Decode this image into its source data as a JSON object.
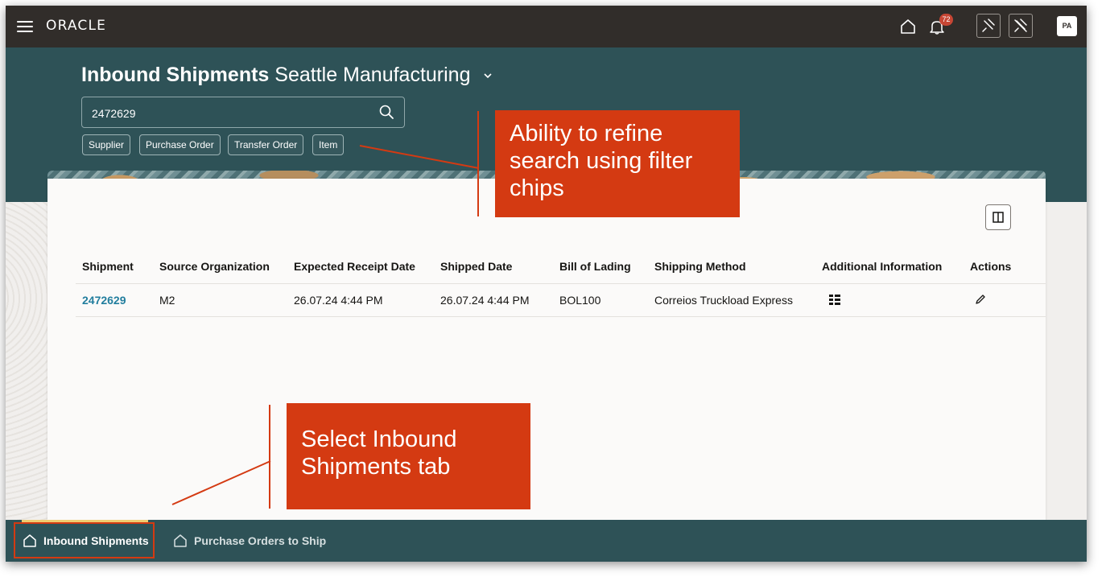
{
  "topbar": {
    "brand": "ORACLE",
    "notification_count": "72",
    "avatar_initials": "PA",
    "icons": [
      "menu-icon",
      "home-icon",
      "bell-icon",
      "pin-icon",
      "unpin-icon"
    ]
  },
  "header": {
    "title": "Inbound Shipments",
    "organization": "Seattle Manufacturing",
    "search_value": "2472629",
    "filter_chips": [
      "Supplier",
      "Purchase Order",
      "Transfer Order",
      "Item"
    ]
  },
  "table": {
    "columns": [
      "Shipment",
      "Source Organization",
      "Expected Receipt Date",
      "Shipped Date",
      "Bill of Lading",
      "Shipping Method",
      "Additional Information",
      "Actions"
    ],
    "rows": [
      {
        "shipment": "2472629",
        "source_organization": "M2",
        "expected_receipt_date": "26.07.24 4:44 PM",
        "shipped_date": "26.07.24 4:44 PM",
        "bill_of_lading": "BOL100",
        "shipping_method": "Correios Truckload Express"
      }
    ]
  },
  "bottom_tabs": [
    {
      "label": "Inbound Shipments",
      "active": true
    },
    {
      "label": "Purchase Orders to Ship",
      "active": false
    }
  ],
  "callouts": {
    "filter_chips": "Ability to refine search using filter chips",
    "select_tab": "Select Inbound Shipments tab"
  },
  "colors": {
    "topbar": "#312d2a",
    "header_band": "#2e5257",
    "link": "#227e9e",
    "callout": "#d43a12",
    "active_tab_indicator": "#f0cc71"
  }
}
